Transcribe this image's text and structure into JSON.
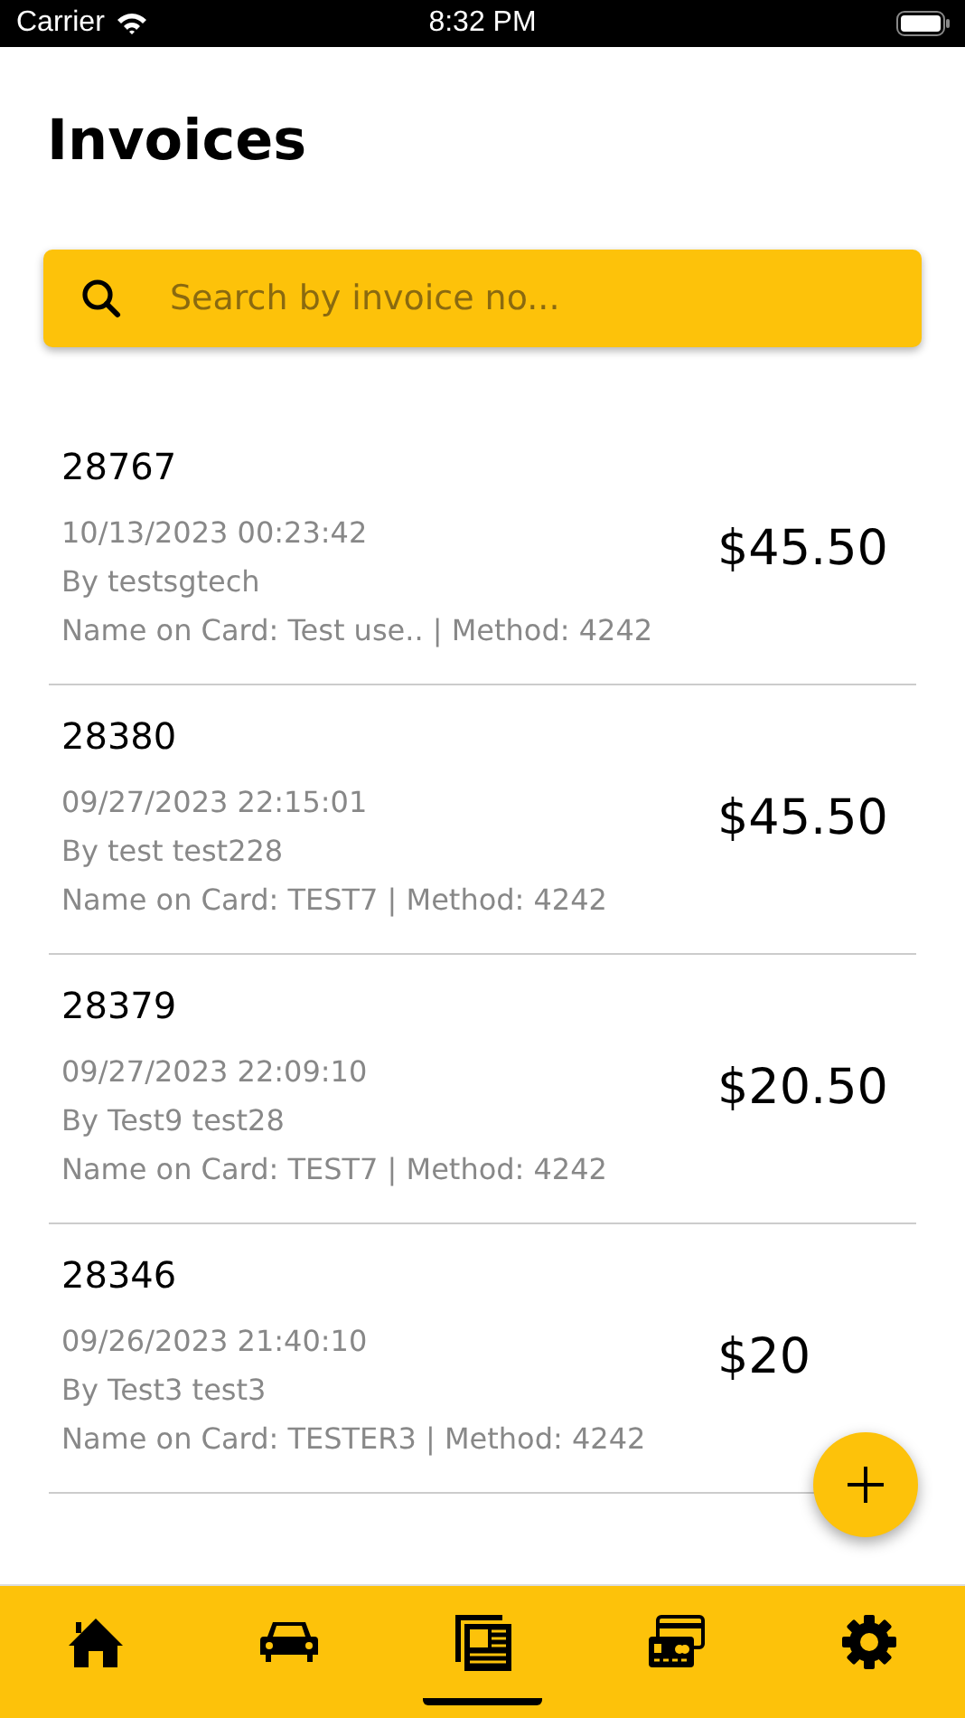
{
  "status_bar": {
    "carrier": "Carrier",
    "time": "8:32 PM"
  },
  "title": "Invoices",
  "search": {
    "placeholder": "Search by invoice no..."
  },
  "invoices": [
    {
      "number": "28767",
      "date": "10/13/2023 00:23:42",
      "by": "By testsgtech",
      "card": "Name on Card: Test use.. | Method: 4242",
      "amount": "$45.50"
    },
    {
      "number": "28380",
      "date": "09/27/2023 22:15:01",
      "by": "By test test228",
      "card": "Name on Card: TEST7 | Method: 4242",
      "amount": "$45.50"
    },
    {
      "number": "28379",
      "date": "09/27/2023 22:09:10",
      "by": "By Test9 test28",
      "card": "Name on Card: TEST7 | Method: 4242",
      "amount": "$20.50"
    },
    {
      "number": "28346",
      "date": "09/26/2023 21:40:10",
      "by": "By Test3 test3",
      "card": "Name on Card: TESTER3 | Method: 4242",
      "amount": "$20"
    }
  ],
  "nav": [
    {
      "kind": "home",
      "selected": false
    },
    {
      "kind": "car",
      "selected": false
    },
    {
      "kind": "invoices",
      "selected": true
    },
    {
      "kind": "cards",
      "selected": false
    },
    {
      "kind": "settings",
      "selected": false
    }
  ]
}
